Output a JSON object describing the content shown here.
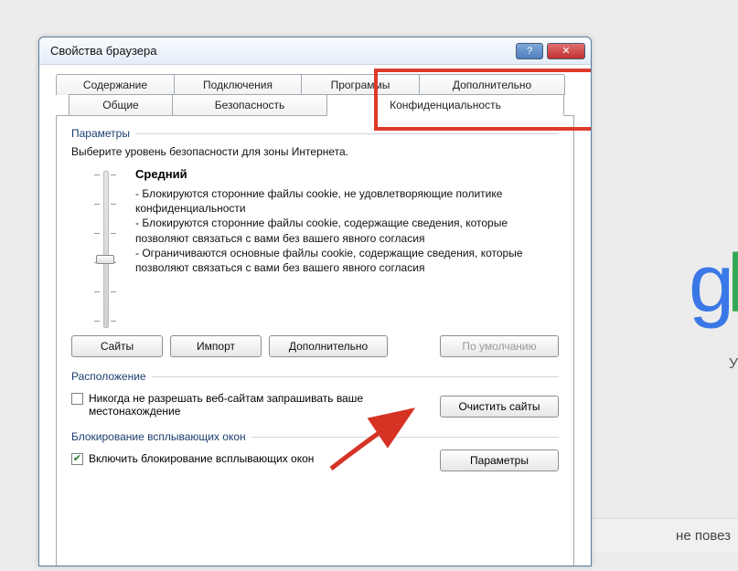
{
  "window": {
    "title": "Свойства браузера",
    "help_label": "?",
    "close_label": "✕"
  },
  "tabs": {
    "row1": [
      "Содержание",
      "Подключения",
      "Программы",
      "Дополнительно"
    ],
    "row2": [
      "Общие",
      "Безопасность",
      "Конфиденциальность"
    ],
    "active": "Конфиденциальность"
  },
  "params": {
    "group_label": "Параметры",
    "instruction": "Выберите уровень безопасности для зоны Интернета.",
    "level_name": "Средний",
    "bullets": [
      "- Блокируются сторонние файлы cookie, не удовлетворяющие политике конфиденциальности",
      "- Блокируются сторонние файлы cookie, содержащие сведения, которые позволяют связаться с вами без вашего явного согласия",
      "- Ограничиваются основные файлы cookie, содержащие сведения, которые позволяют связаться с вами без вашего явного согласия"
    ],
    "buttons": {
      "sites": "Сайты",
      "import": "Импорт",
      "advanced": "Дополнительно",
      "default": "По умолчанию"
    }
  },
  "location": {
    "group_label": "Расположение",
    "checkbox_label": "Никогда не разрешать веб-сайтам запрашивать ваше местонахождение",
    "checked": false,
    "clear_button": "Очистить сайты"
  },
  "popup": {
    "group_label": "Блокирование всплывающих окон",
    "checkbox_label": "Включить блокирование всплывающих окон",
    "checked": true,
    "settings_button": "Параметры"
  },
  "bg": {
    "g": "g",
    "l": "l",
    "subtitle": "У",
    "footer": "не повез"
  }
}
